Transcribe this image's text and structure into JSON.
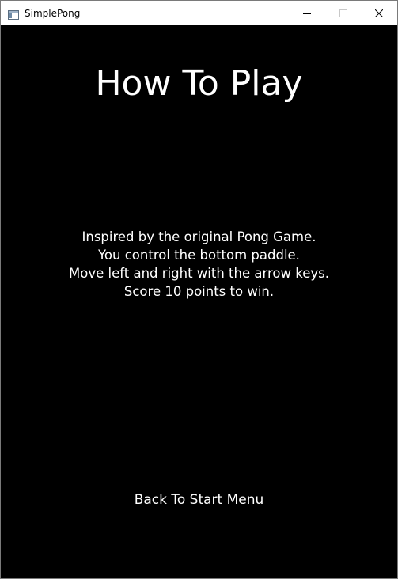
{
  "window": {
    "title": "SimplePong",
    "icon": "application-window-icon",
    "controls": [
      "minimize-icon",
      "maximize-icon",
      "close-icon"
    ]
  },
  "screen": {
    "heading": "How To Play",
    "instructions": [
      "Inspired by the original Pong Game.",
      "You control the bottom paddle.",
      "Move left and right with the arrow keys.",
      "Score 10 points to win."
    ],
    "back_label": "Back To Start Menu"
  },
  "colors": {
    "background": "#000000",
    "text": "#ffffff",
    "titlebar": "#ffffff"
  }
}
